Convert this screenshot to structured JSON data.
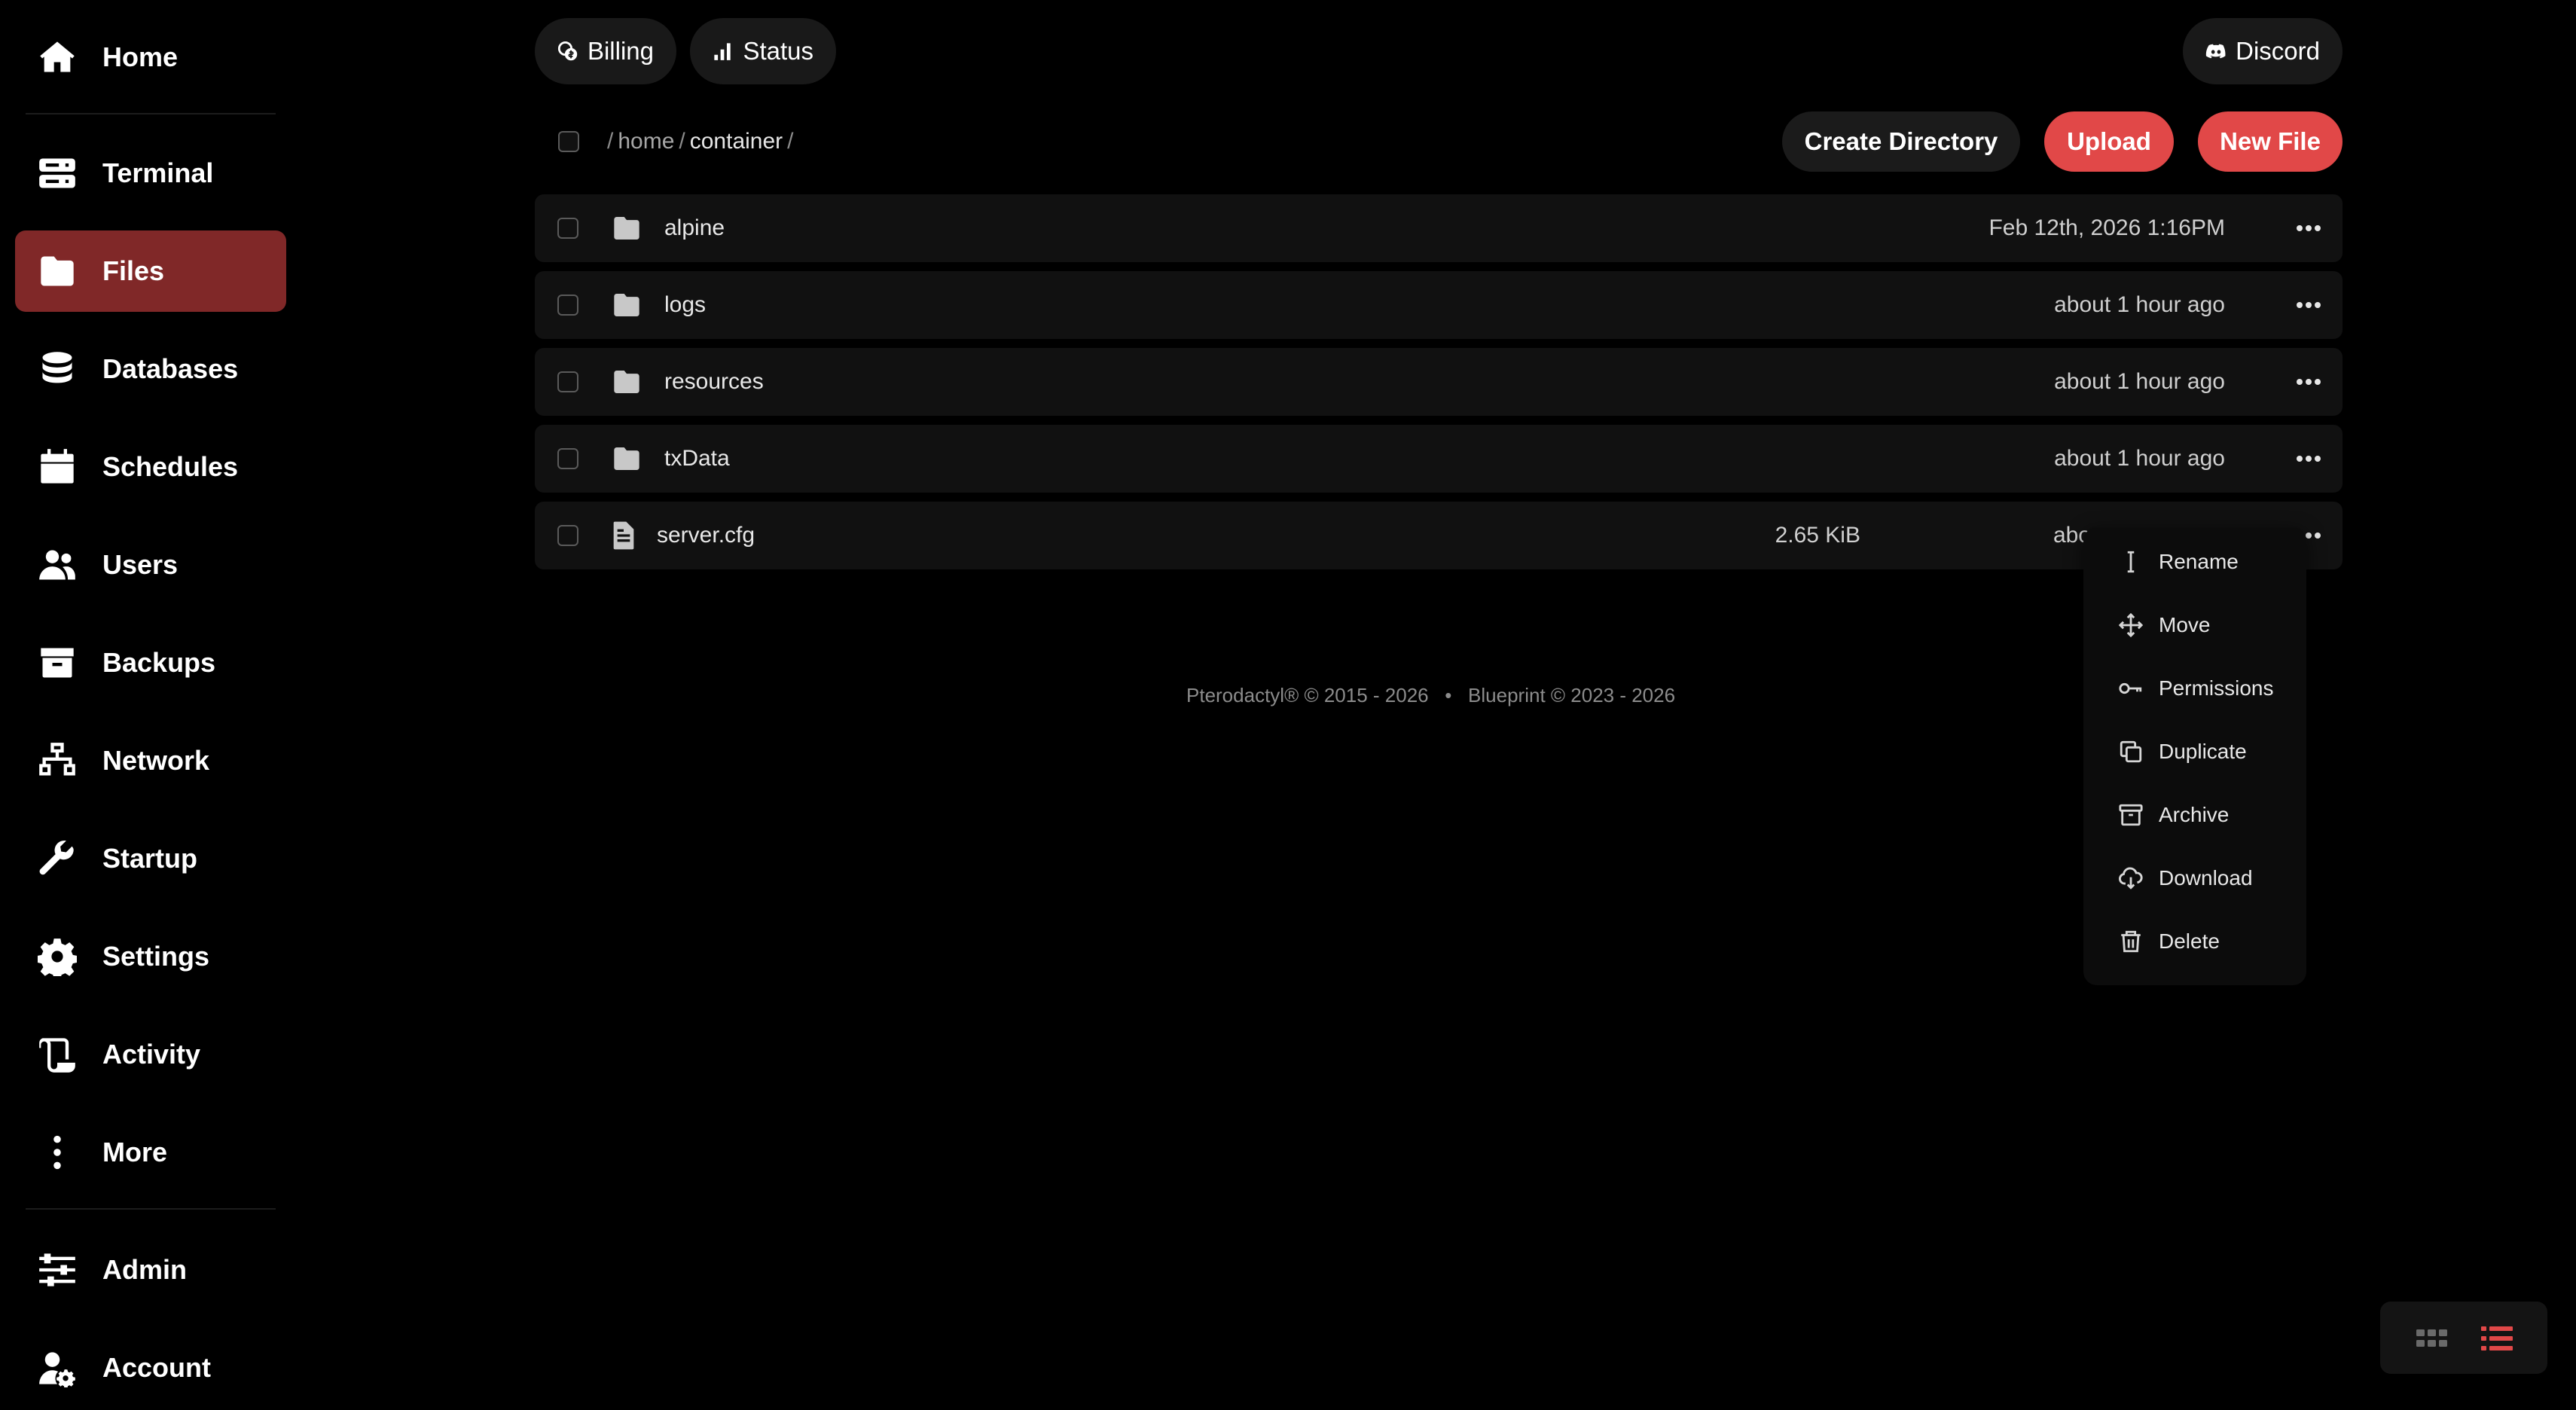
{
  "sidebar": {
    "items": [
      {
        "label": "Home",
        "icon": "home-icon"
      },
      {
        "label": "Terminal",
        "icon": "terminal-icon"
      },
      {
        "label": "Files",
        "icon": "folder-icon",
        "active": true
      },
      {
        "label": "Databases",
        "icon": "database-icon"
      },
      {
        "label": "Schedules",
        "icon": "calendar-icon"
      },
      {
        "label": "Users",
        "icon": "users-icon"
      },
      {
        "label": "Backups",
        "icon": "archive-icon"
      },
      {
        "label": "Network",
        "icon": "network-icon"
      },
      {
        "label": "Startup",
        "icon": "wrench-icon"
      },
      {
        "label": "Settings",
        "icon": "gear-icon"
      },
      {
        "label": "Activity",
        "icon": "scroll-icon"
      },
      {
        "label": "More",
        "icon": "vertical-dots-icon"
      },
      {
        "label": "Admin",
        "icon": "sliders-icon"
      },
      {
        "label": "Account",
        "icon": "user-gear-icon"
      }
    ]
  },
  "topbar": {
    "billing_label": "Billing",
    "status_label": "Status",
    "discord_label": "Discord"
  },
  "breadcrumb": {
    "root": "/",
    "segments": [
      "home",
      "container"
    ],
    "trailing": "/"
  },
  "actions": {
    "create_directory": "Create Directory",
    "upload": "Upload",
    "new_file": "New File"
  },
  "files": [
    {
      "name": "alpine",
      "type": "folder",
      "size": "",
      "modified": "Feb 12th, 2026 1:16PM"
    },
    {
      "name": "logs",
      "type": "folder",
      "size": "",
      "modified": "about 1 hour ago"
    },
    {
      "name": "resources",
      "type": "folder",
      "size": "",
      "modified": "about 1 hour ago"
    },
    {
      "name": "txData",
      "type": "folder",
      "size": "",
      "modified": "about 1 hour ago"
    },
    {
      "name": "server.cfg",
      "type": "file",
      "size": "2.65 KiB",
      "modified": "abo"
    }
  ],
  "context_menu": {
    "items": [
      "Rename",
      "Move",
      "Permissions",
      "Duplicate",
      "Archive",
      "Download",
      "Delete"
    ]
  },
  "footer": {
    "text": "Pterodactyl® © 2015 - 2026   •   Blueprint © 2023 - 2026"
  },
  "colors": {
    "accent": "#e14848",
    "active_nav": "#802828",
    "row_bg": "#111111"
  }
}
